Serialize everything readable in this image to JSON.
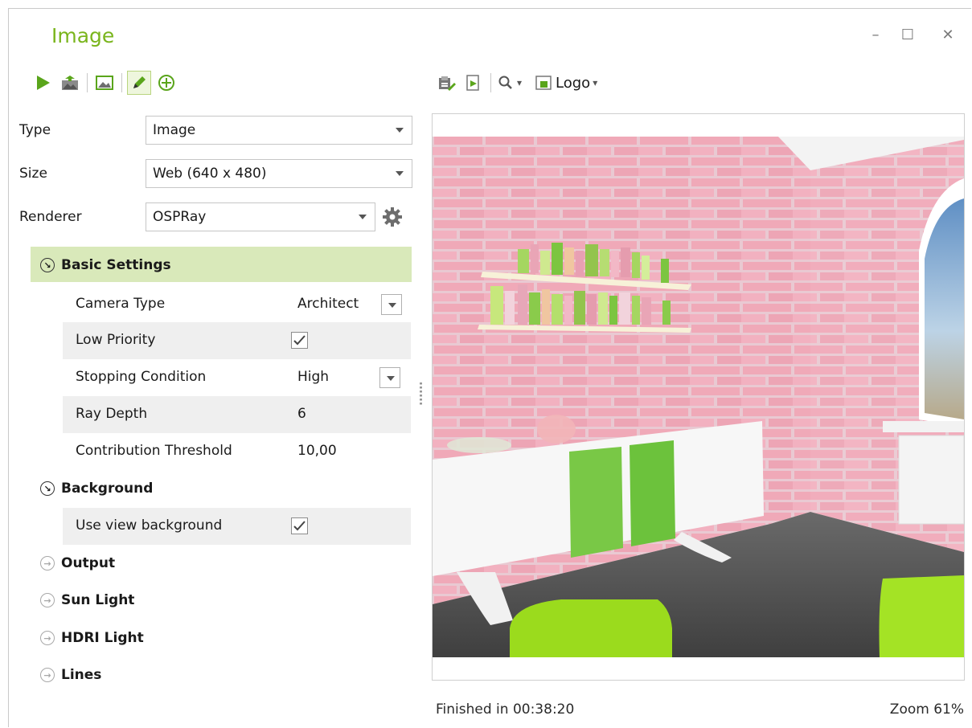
{
  "window": {
    "title": "Image",
    "controls": {
      "minimize": "–",
      "maximize": "☐",
      "close": "✕"
    }
  },
  "toolbar": {
    "zoom_arrow": "▾",
    "logo_label": "Logo",
    "logo_arrow": "▾"
  },
  "fields": {
    "type_label": "Type",
    "type_value": "Image",
    "size_label": "Size",
    "size_value": "Web (640 x 480)",
    "renderer_label": "Renderer",
    "renderer_value": "OSPRay"
  },
  "sections": {
    "basic": "Basic Settings",
    "background": "Background",
    "output": "Output",
    "sun_light": "Sun Light",
    "hdri_light": "HDRI Light",
    "lines": "Lines"
  },
  "basic_settings": {
    "camera_type_label": "Camera Type",
    "camera_type_value": "Architect",
    "low_priority_label": "Low Priority",
    "low_priority_checked": true,
    "stopping_label": "Stopping Condition",
    "stopping_value": "High",
    "ray_depth_label": "Ray Depth",
    "ray_depth_value": "6",
    "contribution_label": "Contribution Threshold",
    "contribution_value": "10,00"
  },
  "background_settings": {
    "use_view_bg_label": "Use view background",
    "use_view_bg_checked": true
  },
  "status": {
    "finished": "Finished in 00:38:20",
    "zoom": "Zoom 61%"
  },
  "colors": {
    "accent": "#7ab51d",
    "section_highlight": "#d9e9ba"
  }
}
